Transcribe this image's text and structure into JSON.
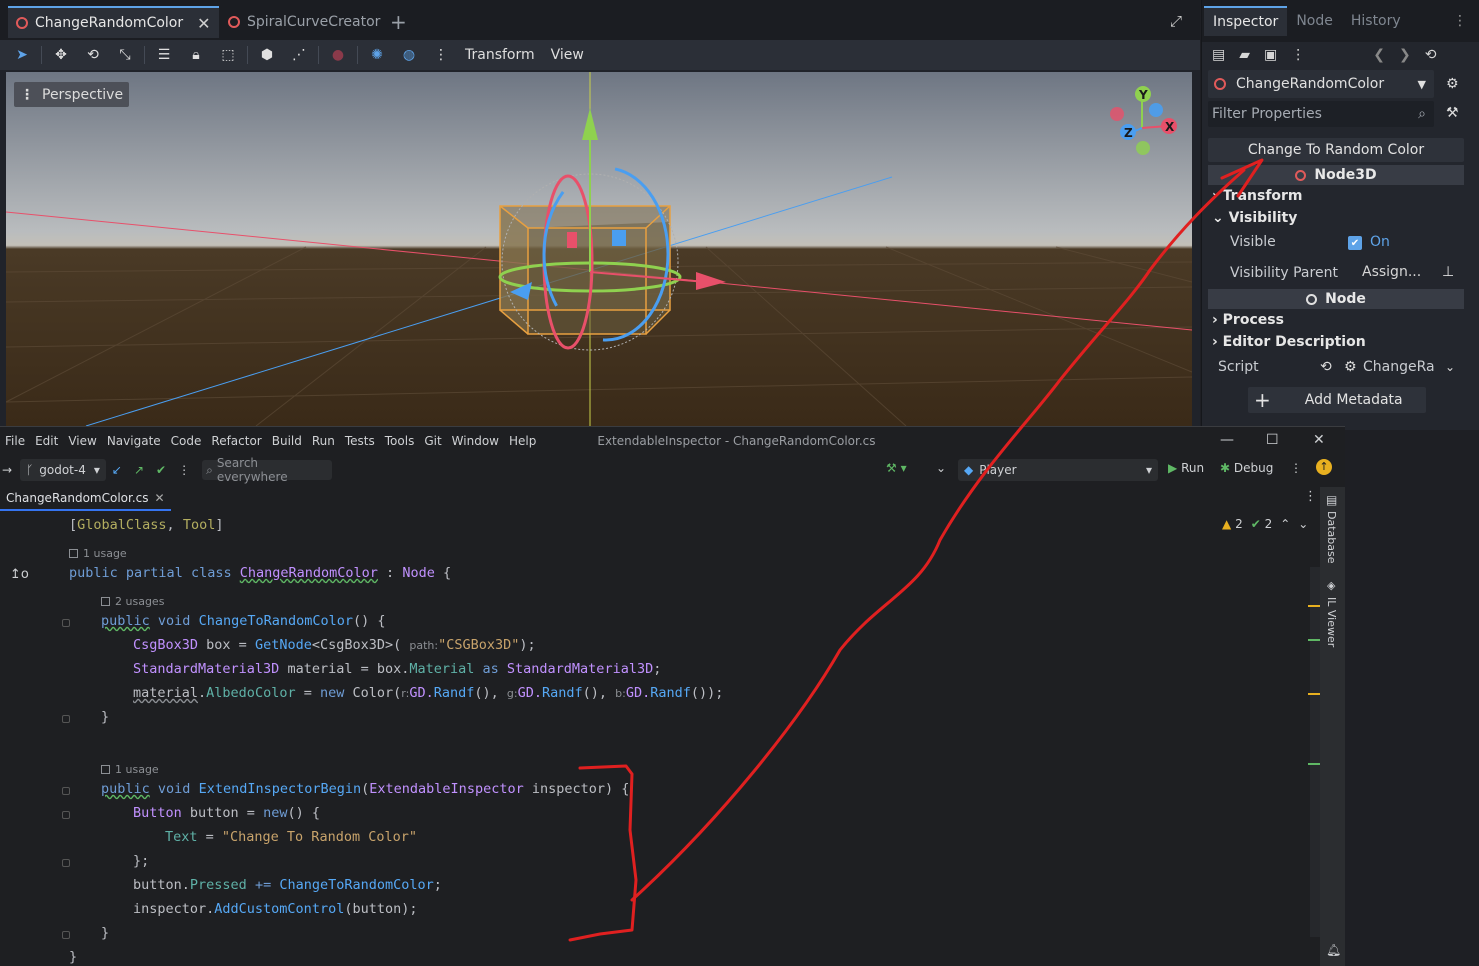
{
  "godot": {
    "tabs": [
      {
        "label": "ChangeRandomColor",
        "active": true
      },
      {
        "label": "SpiralCurveCreator",
        "active": false
      }
    ],
    "toolbar_menus": [
      "Transform",
      "View"
    ],
    "viewport_mode": "Perspective",
    "gizmo_axes": [
      "Y",
      "X",
      "Z"
    ]
  },
  "inspector": {
    "tabs": [
      "Inspector",
      "Node",
      "History"
    ],
    "selected_node": "ChangeRandomColor",
    "filter_placeholder": "Filter Properties",
    "custom_button": "Change To Random Color",
    "category_node3d": "Node3D",
    "section_transform": "Transform",
    "section_visibility": "Visibility",
    "visible_label": "Visible",
    "visible_value": "On",
    "visibility_parent_label": "Visibility Parent",
    "visibility_parent_value": "Assign...",
    "category_node": "Node",
    "section_process": "Process",
    "section_editor_description": "Editor Description",
    "script_label": "Script",
    "script_value": "ChangeRa",
    "add_metadata": "Add Metadata"
  },
  "rider": {
    "menu": [
      "File",
      "Edit",
      "View",
      "Navigate",
      "Code",
      "Refactor",
      "Build",
      "Run",
      "Tests",
      "Tools",
      "Git",
      "Window",
      "Help"
    ],
    "window_title": "ExtendableInspector - ChangeRandomColor.cs",
    "branch": "godot-4",
    "search_placeholder": "Search everywhere",
    "run_config": "Player",
    "run_label": "Run",
    "debug_label": "Debug",
    "file_tab": "ChangeRandomColor.cs",
    "warnings": "2",
    "checks": "2",
    "side_database": "Database",
    "side_il_viewer": "IL Viewer",
    "hints": {
      "usage_1": "1 usage",
      "usages_2": "2 usages",
      "usage_1b": "1 usage",
      "path_label": "path:",
      "r_label": "r:",
      "g_label": "g:",
      "b_label": "b:"
    },
    "code": {
      "attr_open": "[",
      "attr_global": "GlobalClass",
      "attr_sep": ", ",
      "attr_tool": "Tool",
      "attr_close": "]",
      "kw_public": "public",
      "kw_partial": "partial",
      "kw_class": "class",
      "class_name": "ChangeRandomColor",
      "colon": " : ",
      "base_class": "Node",
      "open_brace": " {",
      "kw_void": "void",
      "method1": "ChangeToRandomColor",
      "parens_brace": "() {",
      "t_csg": "CsgBox3D",
      "v_box": " box = ",
      "getnode": "GetNode",
      "generic": "<CsgBox3D>(",
      "str_path": "\"CSGBox3D\"",
      "close_semi": ");",
      "t_mat": "StandardMaterial3D",
      "v_mat": " material = box.",
      "p_material": "Material",
      "kw_as": " as ",
      "t_mat2": "StandardMaterial3D",
      "semi": ";",
      "v_material": "material",
      "dot": ".",
      "p_albedo": "AlbedoColor",
      "eq": " = ",
      "kw_new": "new",
      "t_color": " Color(",
      "gd": "GD.",
      "randf": "Randf",
      "call_comma": "(), ",
      "call_end": "());",
      "close_brace": "}",
      "method2": "ExtendInspectorBegin",
      "param_open": "(",
      "t_ext": "ExtendableInspector",
      "param_rest": " inspector) {",
      "t_button": "Button",
      "v_button": " button = ",
      "new_open": "() {",
      "p_text": "Text",
      "str_text": "\"Change To Random Color\"",
      "close_brace_semi": "};",
      "v_button2": "button.",
      "p_pressed": "Pressed",
      "plus_eq": " += ",
      "m_change": "ChangeToRandomColor",
      "v_inspector": "inspector.",
      "m_add": "AddCustomControl",
      "arg_button": "(button);"
    }
  },
  "colors": {
    "accent": "#5ea3e8",
    "annotation": "#e02020",
    "x_axis": "#e8506a",
    "y_axis": "#8fd14f",
    "z_axis": "#4a9ef0",
    "cube": "#e8a040"
  }
}
